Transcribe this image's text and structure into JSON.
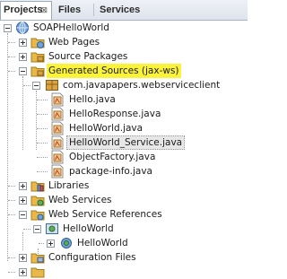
{
  "tabs": [
    {
      "label": "Projects",
      "close": "⊠",
      "active": true
    },
    {
      "label": "Files",
      "active": false
    },
    {
      "label": "Services",
      "active": false
    }
  ],
  "tree": {
    "project": "SOAPHelloWorld",
    "web_pages": "Web Pages",
    "source_packages": "Source Packages",
    "generated_sources": "Generated Sources (jax-ws)",
    "package": "com.javapapers.webserviceclient",
    "files": [
      "Hello.java",
      "HelloResponse.java",
      "HelloWorld.java",
      "HelloWorld_Service.java",
      "ObjectFactory.java",
      "package-info.java"
    ],
    "libraries": "Libraries",
    "web_services": "Web Services",
    "web_service_references": "Web Service References",
    "ref_service": "HelloWorld",
    "ref_port": "HelloWorld",
    "configuration_files": "Configuration Files"
  },
  "colors": {
    "highlight": "#fbf33a",
    "folder": "#e8b94a",
    "package": "#d9a441"
  }
}
